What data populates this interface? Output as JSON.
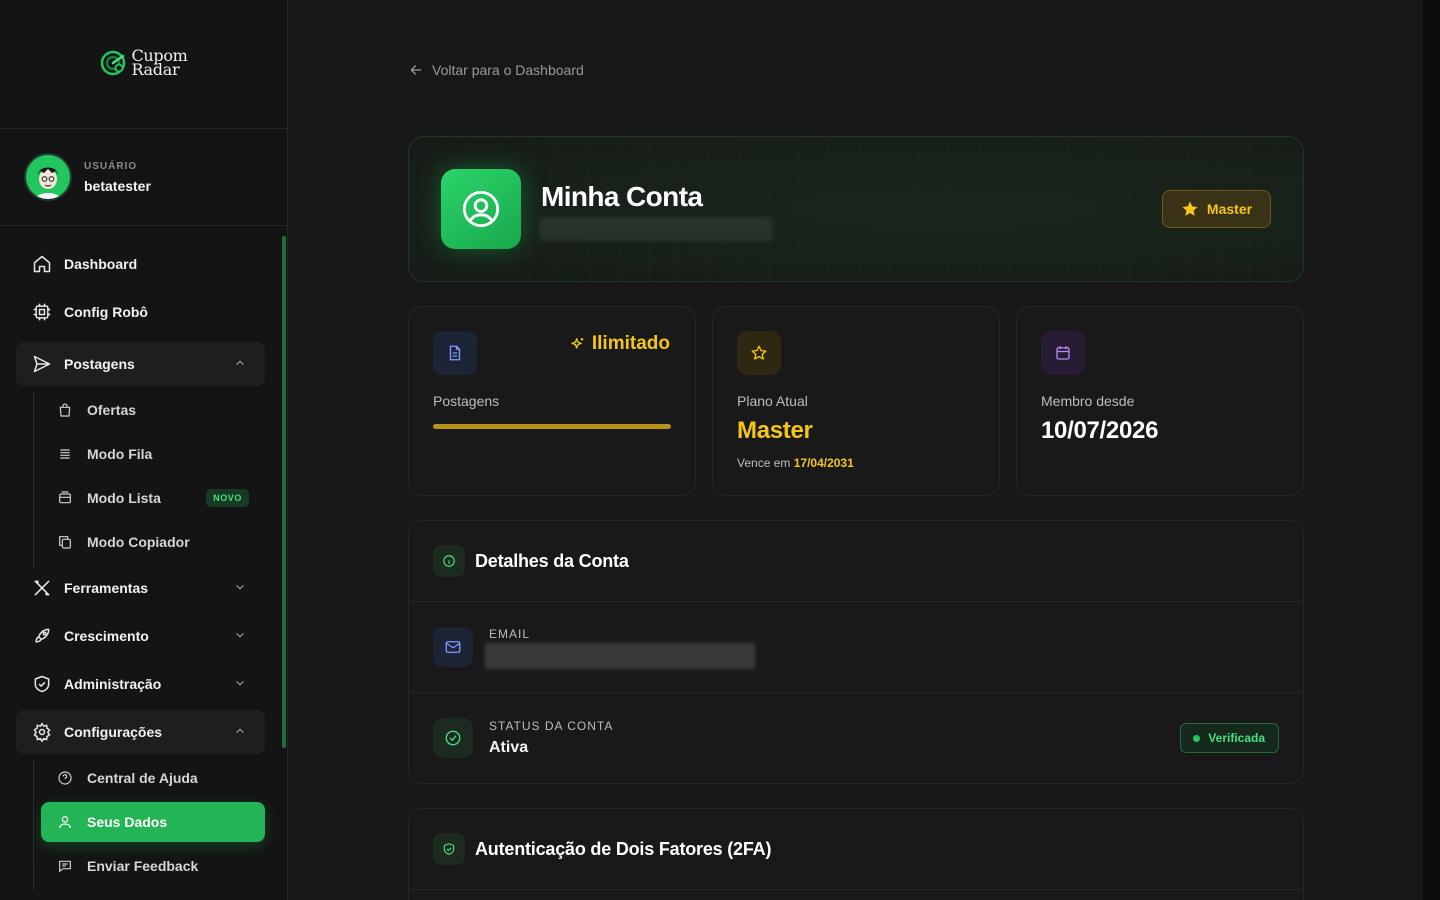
{
  "brand": {
    "line1": "Cupom",
    "line2": "Radar"
  },
  "user": {
    "role_label": "USUÁRIO",
    "name": "betatester"
  },
  "sidebar": {
    "items": [
      {
        "label": "Dashboard",
        "icon": "home-icon"
      },
      {
        "label": "Config Robô",
        "icon": "cpu-icon"
      },
      {
        "label": "Postagens",
        "icon": "send-icon",
        "expanded": true
      },
      {
        "label": "Ferramentas",
        "icon": "tools-icon",
        "expanded": false
      },
      {
        "label": "Crescimento",
        "icon": "rocket-icon",
        "expanded": false
      },
      {
        "label": "Administração",
        "icon": "shield-icon",
        "expanded": false
      },
      {
        "label": "Configurações",
        "icon": "gear-icon",
        "expanded": true
      }
    ],
    "postagens_sub": [
      {
        "label": "Ofertas",
        "icon": "shopping-bag-icon"
      },
      {
        "label": "Modo Fila",
        "icon": "list-icon"
      },
      {
        "label": "Modo Lista",
        "icon": "archive-icon",
        "badge": "NOVO"
      },
      {
        "label": "Modo Copiador",
        "icon": "copy-icon"
      }
    ],
    "config_sub": [
      {
        "label": "Central de Ajuda",
        "icon": "help-circle-icon"
      },
      {
        "label": "Seus Dados",
        "icon": "user-icon",
        "active": true
      },
      {
        "label": "Enviar Feedback",
        "icon": "message-icon"
      }
    ]
  },
  "back_link": "Voltar para o Dashboard",
  "hero": {
    "title": "Minha Conta",
    "plan_badge": "Master"
  },
  "stats": {
    "postagens": {
      "label": "Postagens",
      "limit_text": "Ilimitado",
      "progress": 1.0
    },
    "plano": {
      "label": "Plano Atual",
      "value": "Master",
      "expire_prefix": "Vence em",
      "expire_date": "17/04/2031"
    },
    "membro": {
      "label": "Membro desde",
      "value": "10/07/2026"
    }
  },
  "details": {
    "title": "Detalhes da Conta",
    "email_label": "EMAIL",
    "status_label": "STATUS DA CONTA",
    "status_value": "Ativa",
    "status_badge": "Verificada"
  },
  "twofa": {
    "title": "Autenticação de Dois Fatores (2FA)"
  },
  "colors": {
    "accent": "#22c55e",
    "gold": "#f5c518",
    "background": "#161616"
  }
}
